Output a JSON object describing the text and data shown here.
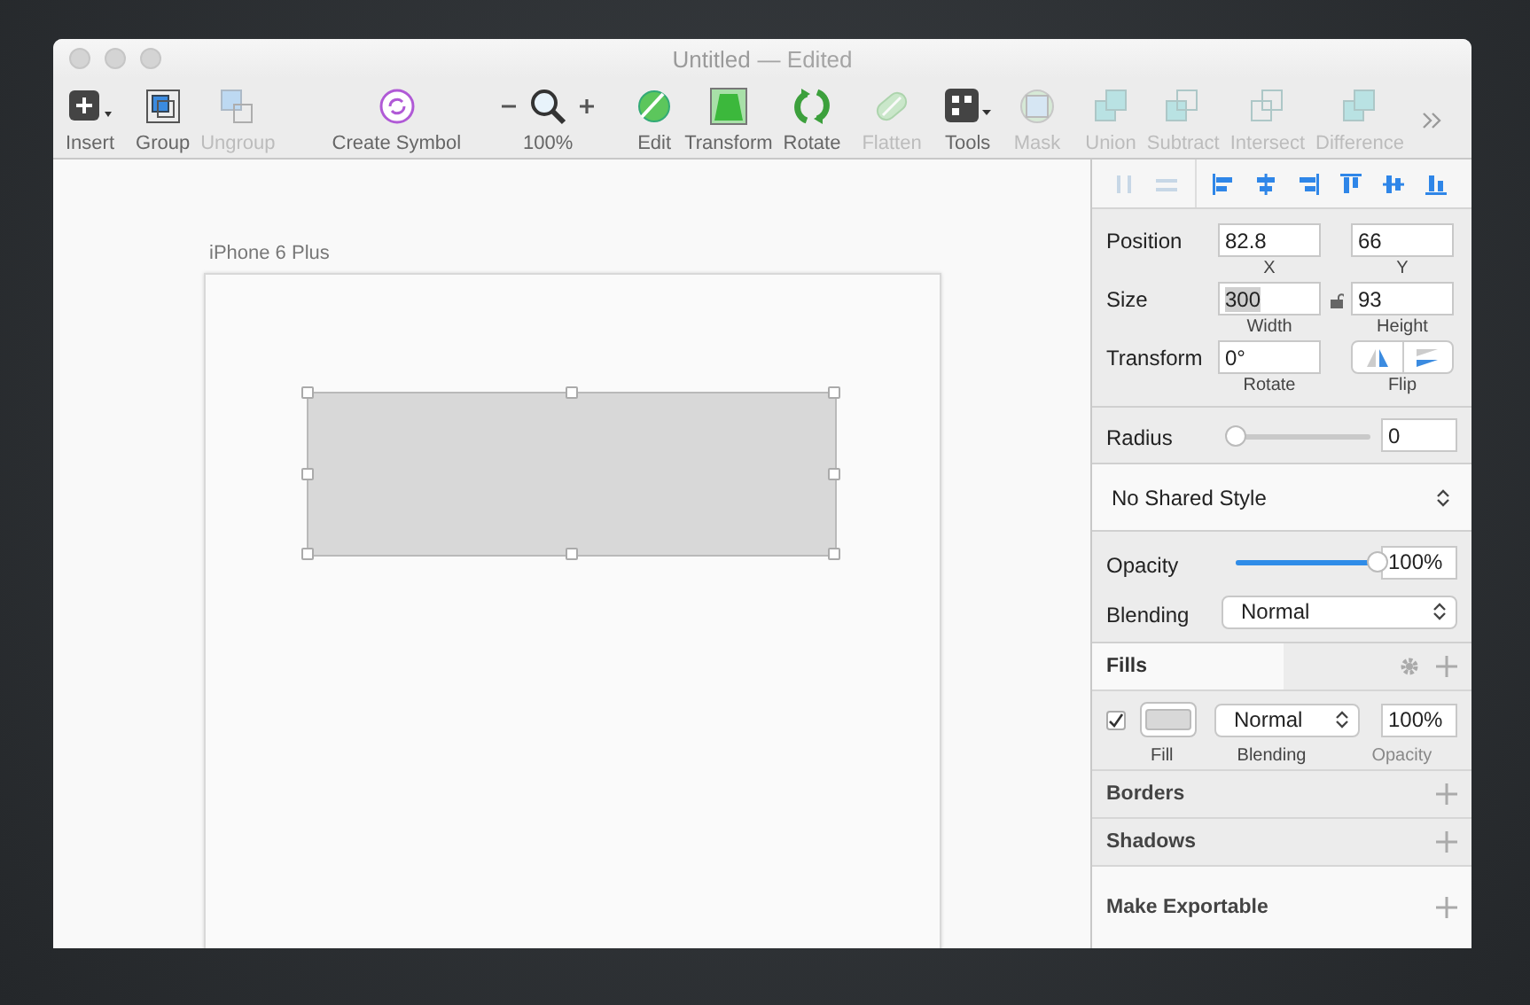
{
  "window": {
    "title": "Untitled",
    "subtitle": "— Edited"
  },
  "toolbar": [
    {
      "kind": "insert",
      "label": "Insert",
      "disabled": false
    },
    {
      "kind": "group",
      "label": "Group",
      "disabled": false
    },
    {
      "kind": "ungroup",
      "label": "Ungroup",
      "disabled": true
    },
    {
      "kind": "symbol",
      "label": "Create Symbol",
      "disabled": false
    },
    {
      "kind": "zoom",
      "label": "100%",
      "disabled": false
    },
    {
      "kind": "edit",
      "label": "Edit",
      "disabled": false
    },
    {
      "kind": "transform",
      "label": "Transform",
      "disabled": false
    },
    {
      "kind": "rotate",
      "label": "Rotate",
      "disabled": false
    },
    {
      "kind": "flatten",
      "label": "Flatten",
      "disabled": true
    },
    {
      "kind": "tools",
      "label": "Tools",
      "disabled": false
    },
    {
      "kind": "mask",
      "label": "Mask",
      "disabled": true
    },
    {
      "kind": "union",
      "label": "Union",
      "disabled": true
    },
    {
      "kind": "subtract",
      "label": "Subtract",
      "disabled": true
    },
    {
      "kind": "intersect",
      "label": "Intersect",
      "disabled": true
    },
    {
      "kind": "difference",
      "label": "Difference",
      "disabled": true
    }
  ],
  "canvas": {
    "artboard_name": "iPhone 6 Plus"
  },
  "inspector": {
    "align_buttons": [
      {
        "kind": "distribute-h",
        "disabled": true
      },
      {
        "kind": "distribute-v",
        "disabled": true
      },
      {
        "kind": "align-left",
        "disabled": false
      },
      {
        "kind": "align-center",
        "disabled": false
      },
      {
        "kind": "align-right",
        "disabled": false
      },
      {
        "kind": "align-top",
        "disabled": false
      },
      {
        "kind": "align-middle",
        "disabled": false
      },
      {
        "kind": "align-bottom",
        "disabled": false
      }
    ],
    "position": {
      "label": "Position",
      "x": {
        "value": "82.8",
        "caption": "X"
      },
      "y": {
        "value": "66",
        "caption": "Y"
      }
    },
    "size": {
      "label": "Size",
      "width": {
        "value": "300",
        "caption": "Width",
        "text_selected": true
      },
      "height": {
        "value": "93",
        "caption": "Height"
      }
    },
    "transform": {
      "label": "Transform",
      "rotate": {
        "value": "0°",
        "caption": "Rotate"
      },
      "flip_caption": "Flip"
    },
    "radius": {
      "label": "Radius",
      "level": 0,
      "value": "0"
    },
    "shared_style": "No Shared Style",
    "opacity": {
      "label": "Opacity",
      "level": 1,
      "value": "100%"
    },
    "blending": {
      "label": "Blending",
      "value": "Normal"
    },
    "fills": {
      "title": "Fills",
      "items": [
        {
          "checked": true,
          "color": "#d8d8d8",
          "blending": "Normal",
          "opacity": "100%"
        }
      ],
      "captions": [
        "Fill",
        "Blending",
        "Opacity"
      ]
    },
    "sections": [
      {
        "title": "Borders"
      },
      {
        "title": "Shadows"
      },
      {
        "title": "Make Exportable"
      }
    ]
  }
}
